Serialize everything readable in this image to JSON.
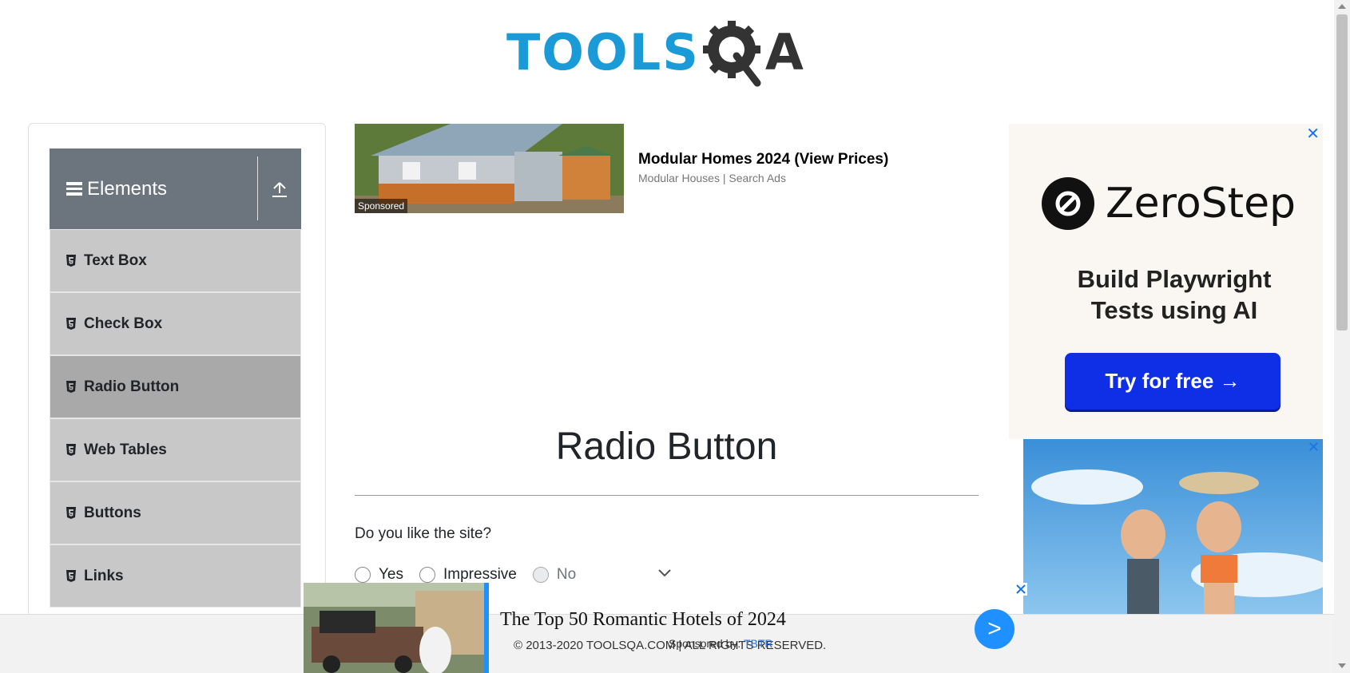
{
  "header": {
    "logo_text": "TOOLSQA",
    "logo_part1": "TOOLS",
    "logo_part2": "A"
  },
  "sidebar": {
    "group_title": "Elements",
    "items": [
      {
        "label": "Text Box",
        "active": false
      },
      {
        "label": "Check Box",
        "active": false
      },
      {
        "label": "Radio Button",
        "active": true
      },
      {
        "label": "Web Tables",
        "active": false
      },
      {
        "label": "Buttons",
        "active": false
      },
      {
        "label": "Links",
        "active": false
      }
    ]
  },
  "top_ad": {
    "sponsored_label": "Sponsored",
    "headline": "Modular Homes 2024 (View Prices)",
    "source": "Modular Houses | Search Ads"
  },
  "main": {
    "title": "Radio Button",
    "question": "Do you like the site?",
    "options": [
      {
        "label": "Yes",
        "disabled": false
      },
      {
        "label": "Impressive",
        "disabled": false
      },
      {
        "label": "No",
        "disabled": true
      }
    ]
  },
  "right_ad": {
    "brand": "ZeroStep",
    "tagline_line1": "Build Playwright",
    "tagline_line2": "Tests using AI",
    "cta": "Try for free →",
    "close": "✕"
  },
  "image_ad": {
    "close": "✕"
  },
  "footer": {
    "copyright": "© 2013-2020 TOOLSQA.COM | ALL RIGHTS RESERVED."
  },
  "bottom_ad": {
    "headline": "The Top 50 Romantic Hotels of 2024",
    "sponsor_prefix": "Sponsored by:",
    "sponsor_name": "TBTR",
    "next": ">"
  },
  "colors": {
    "logo_blue": "#1a9ad6",
    "sidebar_header": "#6c757d",
    "menu_item": "#c8c8c8",
    "menu_item_active": "#a9a9a9",
    "cta_blue": "#0f2fe6",
    "next_button": "#1e90ff"
  }
}
